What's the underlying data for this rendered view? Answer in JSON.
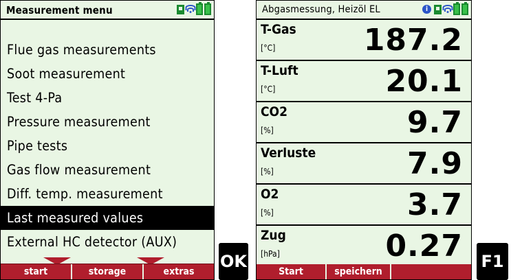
{
  "left_screen": {
    "title": "Measurement menu",
    "menu_items": [
      "Flue gas measurements",
      "Soot measurement",
      "Test 4-Pa",
      "Pressure measurement",
      "Pipe tests",
      "Gas flow measurement",
      "Diff. temp. measurement",
      "Last measured values",
      "External HC detector (AUX)"
    ],
    "selected_item": "Last measured values",
    "softkeys": [
      "start",
      "storage",
      "extras"
    ]
  },
  "ok_key": "OK",
  "right_screen": {
    "title": "Abgasmessung, Heizöl EL",
    "info_icon": "i",
    "rows": [
      {
        "label": "T-Gas",
        "unit": "[°C]",
        "value": "187.2"
      },
      {
        "label": "T-Luft",
        "unit": "[°C]",
        "value": "20.1"
      },
      {
        "label": "CO2",
        "unit": "[%]",
        "value": "9.7"
      },
      {
        "label": "Verluste",
        "unit": "[%]",
        "value": "7.9"
      },
      {
        "label": "O2",
        "unit": "[%]",
        "value": "3.7"
      },
      {
        "label": "Zug",
        "unit": "[hPa]",
        "value": "0.27"
      }
    ],
    "softkeys": [
      "Start",
      "speichern",
      ""
    ]
  },
  "f1_key": "F1",
  "colors": {
    "screen_bg": "#e9f6e4",
    "softkey_bar": "#b01e2d",
    "battery_green": "#39c04a",
    "wireless_blue": "#2b55c8"
  },
  "icons": [
    "info-icon",
    "memory-chip-icon",
    "wireless-icon",
    "battery-icon"
  ]
}
